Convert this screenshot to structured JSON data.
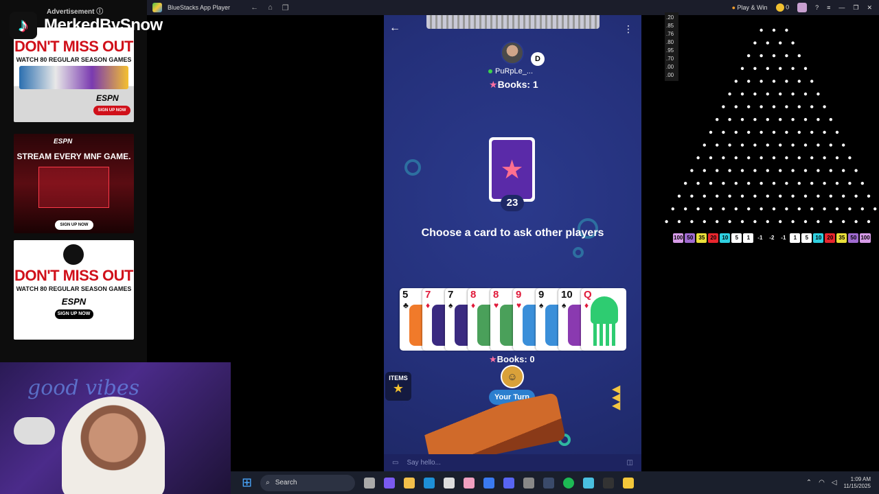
{
  "branding": {
    "logo_glyph": "♪",
    "name": "MerkedBySnow"
  },
  "ads": {
    "header": "Advertisement ⓘ",
    "ad1": {
      "headline": "DON'T MISS OUT",
      "sub": "WATCH 80 REGULAR SEASON GAMES",
      "logo": "ESPN",
      "cta": "SIGN UP NOW"
    },
    "ad2": {
      "logo": "ESPN",
      "headline": "STREAM EVERY MNF GAME.",
      "cta": "SIGN UP NOW"
    },
    "ad3": {
      "headline1": "DON'T MISS OUT",
      "sub": "WATCH 80 REGULAR SEASON GAMES",
      "logo": "ESPN",
      "cta": "SIGN UP NOW"
    }
  },
  "webcam": {
    "neon": "good vibes"
  },
  "titlebar": {
    "app": "BlueStacks App Player",
    "nav": [
      "←",
      "⌂",
      "❐"
    ],
    "play_win": "Play & Win",
    "coins": "0",
    "controls": [
      "?",
      "≡",
      "—",
      "❐",
      "✕"
    ]
  },
  "game": {
    "back": "←",
    "menu": "⋮",
    "opponent": {
      "badge": "D",
      "name": "PuRpLe_...",
      "books": "Books: 1"
    },
    "deck": {
      "count": "23",
      "glyph": "★"
    },
    "prompt": "Choose a card to ask other players",
    "hand": [
      {
        "rank": "5",
        "suit": "♣",
        "color": "black",
        "art": "#f07a2a"
      },
      {
        "rank": "7",
        "suit": "♦",
        "color": "red",
        "art": "#3a2a80"
      },
      {
        "rank": "7",
        "suit": "♠",
        "color": "black",
        "art": "#3a2a80"
      },
      {
        "rank": "8",
        "suit": "♦",
        "color": "red",
        "art": "#4aa05a"
      },
      {
        "rank": "8",
        "suit": "♥",
        "color": "red",
        "art": "#4aa05a"
      },
      {
        "rank": "9",
        "suit": "♥",
        "color": "red",
        "art": "#3a8fd9"
      },
      {
        "rank": "9",
        "suit": "♠",
        "color": "black",
        "art": "#3a8fd9"
      },
      {
        "rank": "10",
        "suit": "♠",
        "color": "black",
        "art": "#8a3ab0"
      },
      {
        "rank": "Q",
        "suit": "♦",
        "color": "red",
        "art": ""
      }
    ],
    "my_books": "Books: 0",
    "items_label": "ITEMS",
    "your_turn": "Your Turn",
    "chat_placeholder": "Say hello..."
  },
  "plinko": {
    "scale": [
      ".20",
      ".85",
      ".76",
      ".80",
      ".95",
      ".70",
      ".00",
      ".00"
    ],
    "slots": [
      {
        "label": "100",
        "color": "#d79be8"
      },
      {
        "label": "50",
        "color": "#a06ad0"
      },
      {
        "label": "35",
        "color": "#e9df3a"
      },
      {
        "label": "20",
        "color": "#e8262e"
      },
      {
        "label": "10",
        "color": "#2fd0e0"
      },
      {
        "label": "5",
        "color": "#ffffff"
      },
      {
        "label": "1",
        "color": "#ffffff"
      },
      {
        "label": "-1",
        "color": "#000000"
      },
      {
        "label": "-2",
        "color": "#000000"
      },
      {
        "label": "-1",
        "color": "#000000"
      },
      {
        "label": "1",
        "color": "#ffffff"
      },
      {
        "label": "5",
        "color": "#ffffff"
      },
      {
        "label": "10",
        "color": "#2fd0e0"
      },
      {
        "label": "20",
        "color": "#e8262e"
      },
      {
        "label": "35",
        "color": "#e9df3a"
      },
      {
        "label": "50",
        "color": "#a06ad0"
      },
      {
        "label": "100",
        "color": "#d79be8"
      }
    ]
  },
  "taskbar": {
    "search": "Search",
    "time": "1:09 AM",
    "date": "11/15/2025"
  }
}
